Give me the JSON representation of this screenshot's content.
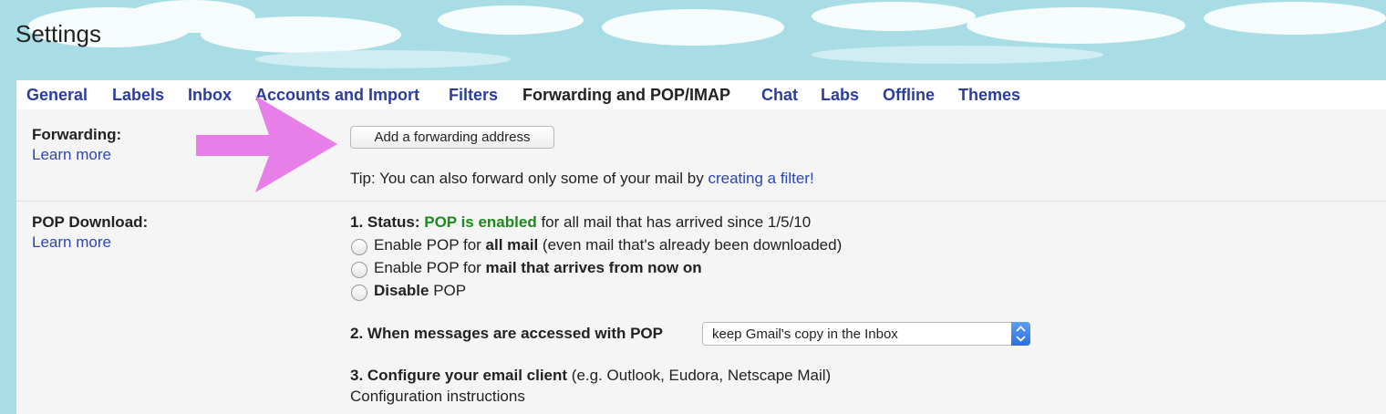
{
  "page": {
    "title": "Settings"
  },
  "tabs": [
    {
      "label": "General"
    },
    {
      "label": "Labels"
    },
    {
      "label": "Inbox"
    },
    {
      "label": "Accounts and Import"
    },
    {
      "label": "Filters"
    },
    {
      "label": "Forwarding and POP/IMAP",
      "active": true
    },
    {
      "label": "Chat"
    },
    {
      "label": "Labs"
    },
    {
      "label": "Offline"
    },
    {
      "label": "Themes"
    }
  ],
  "forwarding": {
    "label": "Forwarding:",
    "learn_more": "Learn more",
    "button_label": "Add a forwarding address",
    "tip_text": "Tip: You can also forward only some of your mail by ",
    "tip_link": "creating a filter!"
  },
  "pop": {
    "label": "POP Download:",
    "learn_more": "Learn more",
    "status_prefix": "1. Status: ",
    "status_value": "POP is enabled",
    "status_suffix": " for all mail that has arrived since 1/5/10",
    "options": [
      {
        "pre": "Enable POP for ",
        "bold": "all mail",
        "post": " (even mail that's already been downloaded)"
      },
      {
        "pre": "Enable POP for ",
        "bold": "mail that arrives from now on",
        "post": ""
      },
      {
        "pre": "",
        "bold": "Disable",
        "post": " POP"
      }
    ],
    "access_label": "2. When messages are accessed with POP",
    "access_select_value": "keep Gmail's copy in the Inbox",
    "configure_label": "3. Configure your email client",
    "configure_note": " (e.g. Outlook, Eudora, Netscape Mail)",
    "configure_link": "Configuration instructions"
  },
  "colors": {
    "background": "#a8dde6",
    "link": "#2b46b8",
    "status_green": "#1a8a1a",
    "annotation_arrow": "#e87ee8"
  }
}
